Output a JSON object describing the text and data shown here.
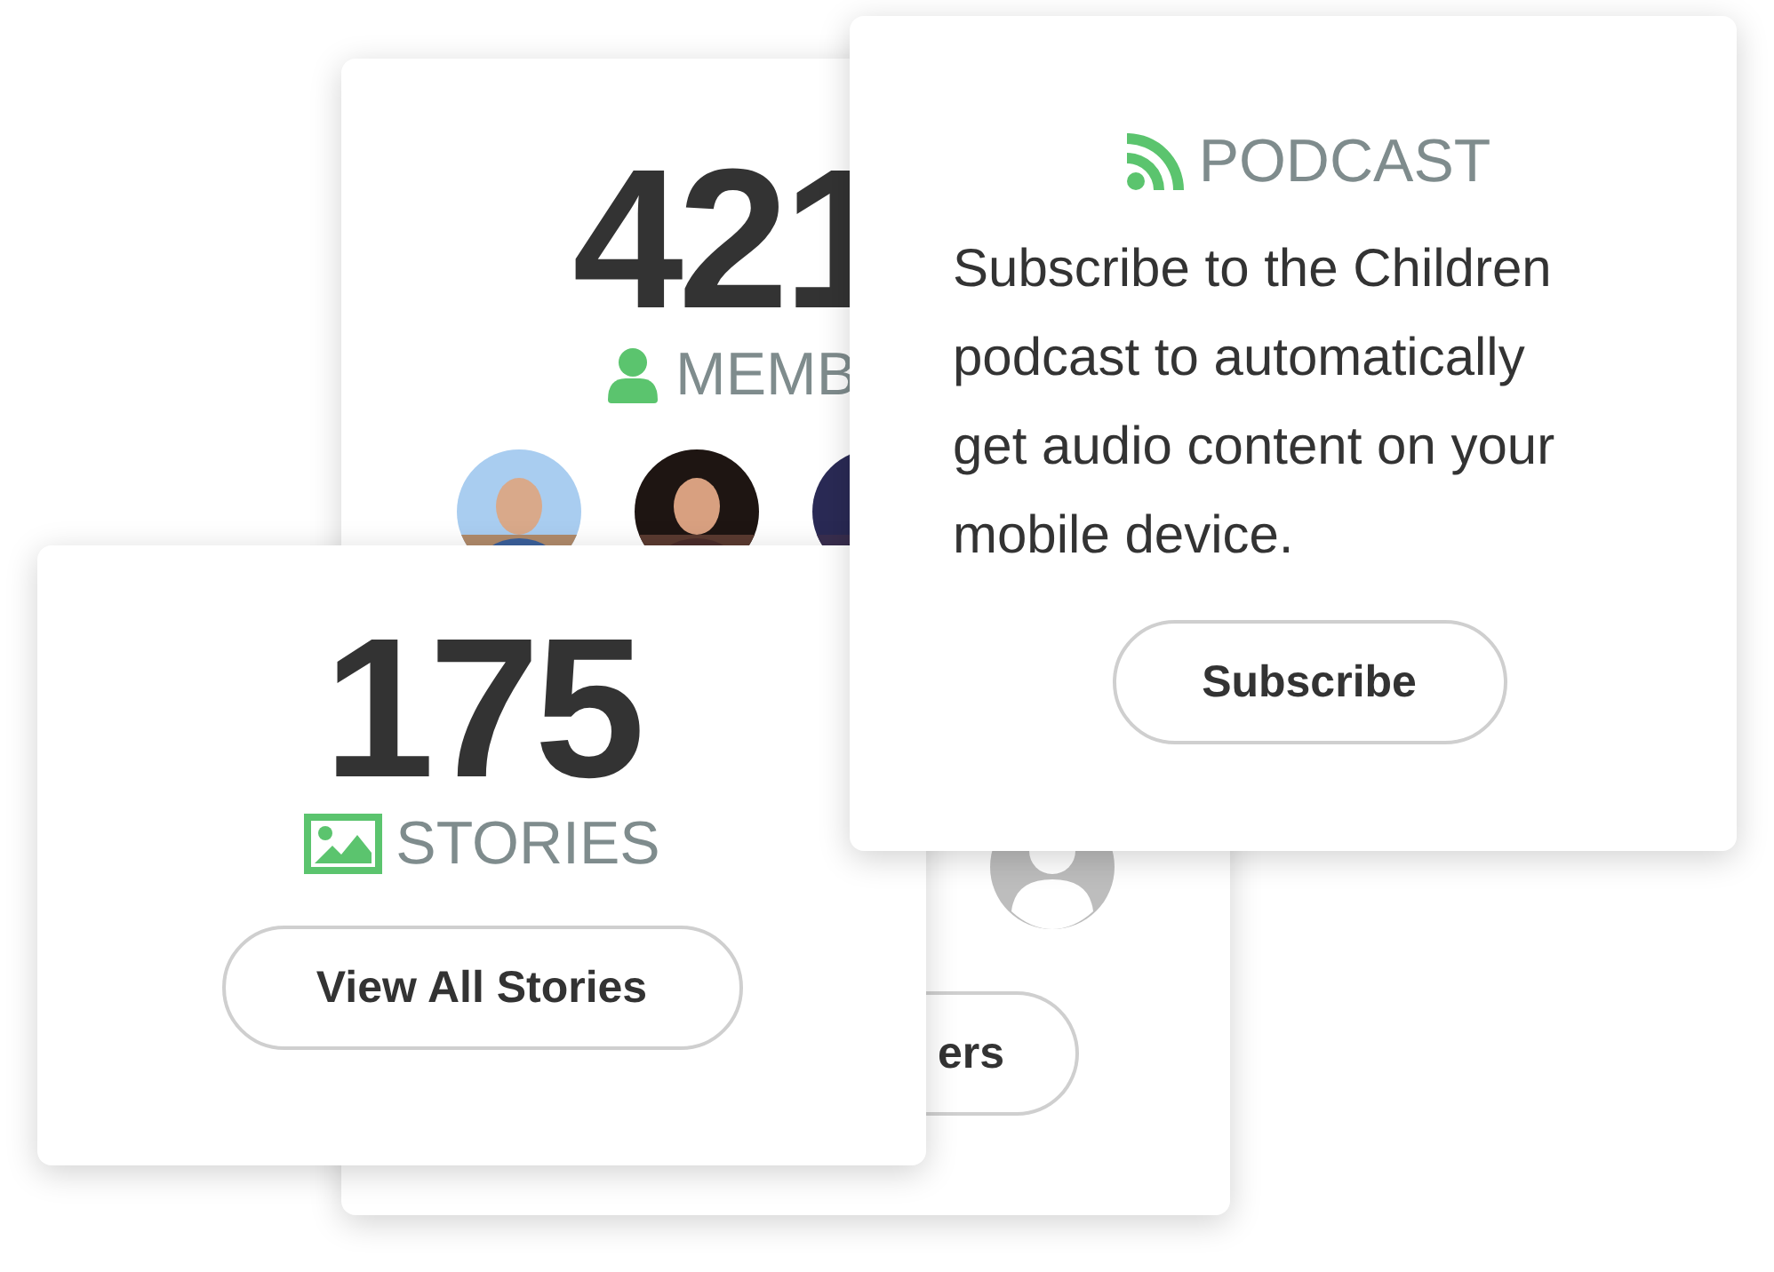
{
  "members_card": {
    "count": "421",
    "label": "MEMB",
    "avatars": [
      {
        "kind": "picture"
      },
      {
        "kind": "picture"
      },
      {
        "kind": "picture"
      },
      {
        "kind": "default"
      }
    ],
    "button": "ers"
  },
  "stories_card": {
    "count": "175",
    "label": "STORIES",
    "button": "View All Stories"
  },
  "podcast_card": {
    "label": "PODCAST",
    "text": "Subscribe to the Children podcast to automatically get audio content on your mobile device.",
    "button": "Subscribe"
  }
}
